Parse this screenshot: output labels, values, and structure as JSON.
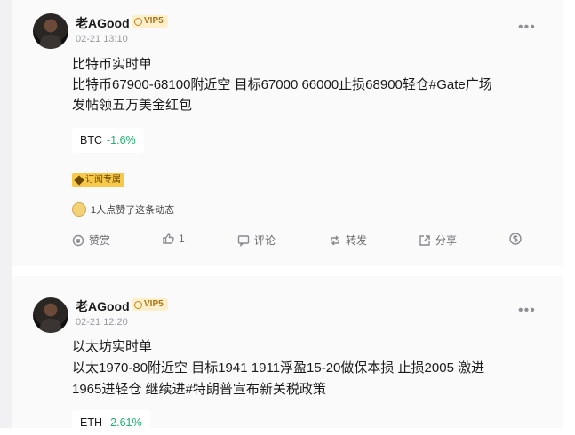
{
  "posts": [
    {
      "author": "老AGood",
      "vip": "VIP5",
      "time": "02-21 13:10",
      "title": "比特币实时单",
      "body_line1": "比特币67900-68100附近空 目标67000 66000止损68900轻仓#Gate广场",
      "body_line2": "发帖领五万美金红包",
      "coin": {
        "symbol": "BTC",
        "change": "-1.6%"
      },
      "subscription_badge": "订阅专属",
      "likes_text": "1人点赞了这条动态",
      "actions": {
        "tip": "赞赏",
        "like_count": "1",
        "comment": "评论",
        "repost": "转发",
        "share": "分享"
      }
    },
    {
      "author": "老AGood",
      "vip": "VIP5",
      "time": "02-21 12:20",
      "title": "以太坊实时单",
      "body_line1": "以太1970-80附近空 目标1941 1911浮盈15-20做保本损 止损2005 激进",
      "body_line2": "1965进轻仓 继续进#特朗普宣布新关税政策",
      "coin": {
        "symbol": "ETH",
        "change": "-2.61%"
      }
    }
  ],
  "colors": {
    "positive": "#20b26c",
    "vip_bg": "#fcefc9",
    "vip_text": "#a8741a",
    "badge_bg": "#f6c94a"
  },
  "icons": [
    "more-icon",
    "tip-icon",
    "like-icon",
    "comment-icon",
    "repost-icon",
    "share-icon",
    "dollar-icon"
  ]
}
